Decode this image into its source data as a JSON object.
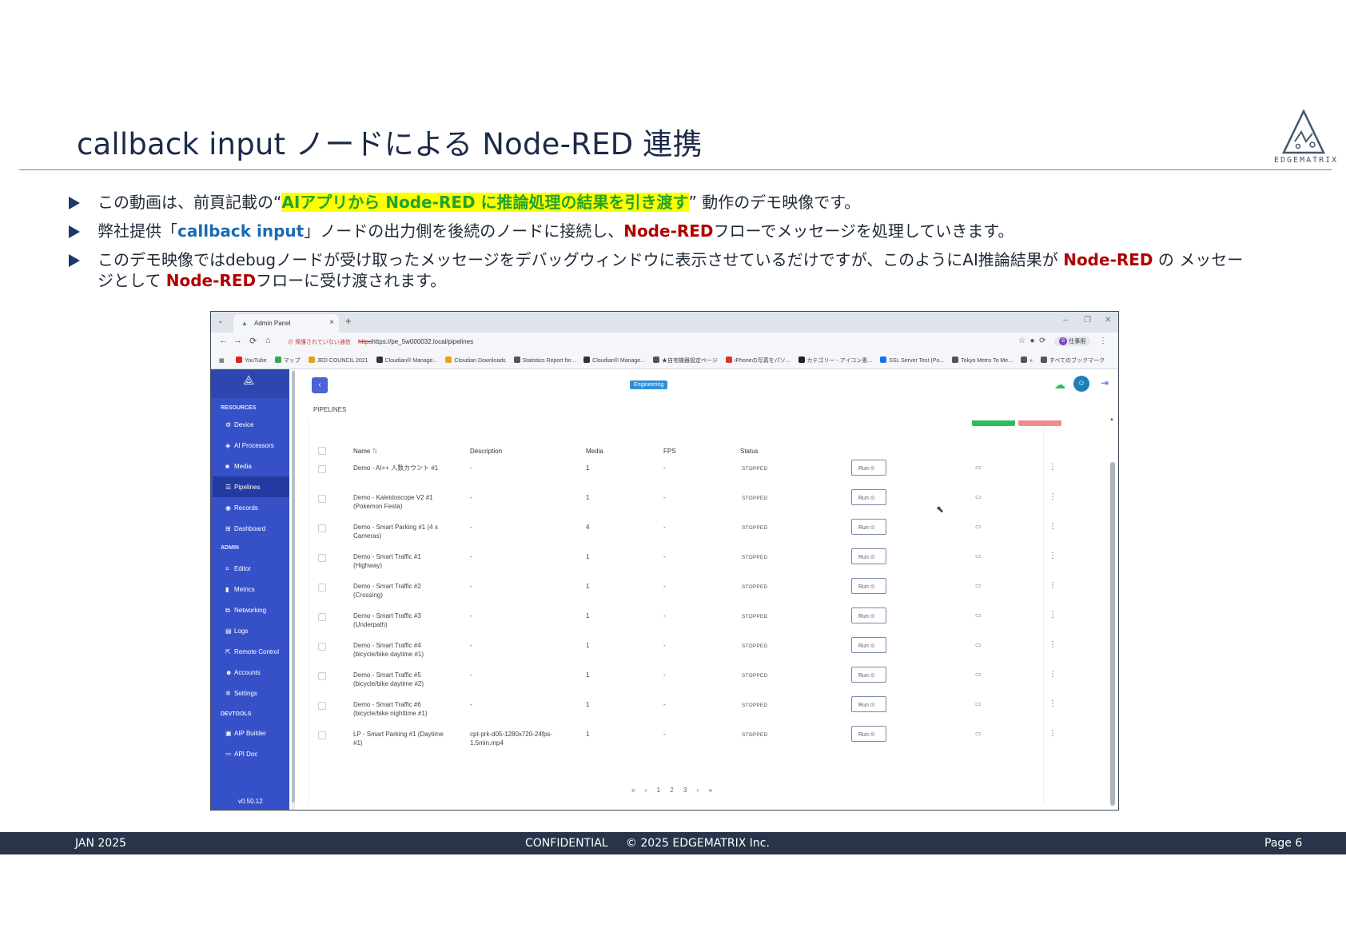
{
  "slide": {
    "title": "callback input ノードによる Node-RED 連携",
    "logo_text": "EDGEMATRIX"
  },
  "bullets": {
    "b1_pre": "この動画は、前頁記載の“",
    "b1_hl": "AIアプリから Node-RED に推論処理の結果を引き渡す",
    "b1_post": "” 動作のデモ映像です。",
    "b2_pre": "弊社提供「",
    "b2_hl": "callback input",
    "b2_mid": "」ノードの出力側を後続のノードに接続し、",
    "b2_red": "Node-RED",
    "b2_post": "フローでメッセージを処理していきます。",
    "b3_pre": "このデモ映像ではdebugノードが受け取ったメッセージをデバッグウィンドウに表示させているだけですが、このようにAI推論結果が ",
    "b3_red1": "Node-RED",
    "b3_mid": " の メッセージとして ",
    "b3_red2": "Node-RED",
    "b3_post": "フローに受け渡されます。"
  },
  "browser": {
    "tab_title": "Admin Panel",
    "security_warning": "保護されていない通信",
    "url": "https://pe_5w000032.local/pipelines",
    "profile": "仕事用",
    "bookmarks": [
      "YouTube",
      "マップ",
      "JED COUNCIL 2021",
      "Cloudian® Manage...",
      "Cloudian Downloads",
      "Statistics Report for...",
      "Cloudian® Manage...",
      "★自宅機器設定ページ",
      "iPhoneの写真をパソ...",
      "カテゴリー - アイコン素...",
      "SSL Server Test (Po...",
      "Tokyo Metro To Me...",
      "»",
      "すべてのブックマーク"
    ],
    "bookmark_colors": [
      "#e62117",
      "#34a853",
      "#e3a21a",
      "#333333",
      "#e8a317",
      "#555555",
      "#333333",
      "#555555",
      "#d9342b",
      "#222222",
      "#1a73e8",
      "#555555",
      "#555555",
      "#555555"
    ]
  },
  "app": {
    "env_badge": "Engineering",
    "breadcrumb": "PIPELINES",
    "version": "v0.50.12",
    "sections": {
      "resources": "RESOURCES",
      "admin": "ADMIN",
      "devtools": "DEVTOOLS"
    },
    "nav": {
      "device": "Device",
      "ai_processors": "AI Processors",
      "media": "Media",
      "pipelines": "Pipelines",
      "records": "Records",
      "dashboard": "Dashboard",
      "editor": "Editor",
      "metrics": "Metrics",
      "networking": "Networking",
      "logs": "Logs",
      "remote_control": "Remote Control",
      "accounts": "Accounts",
      "settings": "Settings",
      "aip_builder": "AIP Builder",
      "api_doc": "API Doc"
    },
    "columns": {
      "name": "Name",
      "description": "Description",
      "media": "Media",
      "fps": "FPS",
      "status": "Status"
    },
    "run_label": "Run",
    "rows": [
      {
        "name1": "Demo - AI++ 人数カウント #1",
        "name2": "",
        "desc1": "-",
        "desc2": "",
        "media": "1",
        "fps": "-",
        "status": "STOPPED"
      },
      {
        "name1": "Demo - Kaleidoscope V2 #1",
        "name2": "(Pokemon Festa)",
        "desc1": "-",
        "desc2": "",
        "media": "1",
        "fps": "-",
        "status": "STOPPED"
      },
      {
        "name1": "Demo - Smart Parking #1 (4 x",
        "name2": "Cameras)",
        "desc1": "-",
        "desc2": "",
        "media": "4",
        "fps": "-",
        "status": "STOPPED"
      },
      {
        "name1": "Demo - Smart Traffic #1",
        "name2": "(Highway)",
        "desc1": "-",
        "desc2": "",
        "media": "1",
        "fps": "-",
        "status": "STOPPED"
      },
      {
        "name1": "Demo - Smart Traffic #2",
        "name2": "(Crossing)",
        "desc1": "-",
        "desc2": "",
        "media": "1",
        "fps": "-",
        "status": "STOPPED"
      },
      {
        "name1": "Demo - Smart Traffic #3",
        "name2": "(Underpath)",
        "desc1": "-",
        "desc2": "",
        "media": "1",
        "fps": "-",
        "status": "STOPPED"
      },
      {
        "name1": "Demo - Smart Traffic #4",
        "name2": "(bicycle/bike daytime #1)",
        "desc1": "-",
        "desc2": "",
        "media": "1",
        "fps": "-",
        "status": "STOPPED"
      },
      {
        "name1": "Demo - Smart Traffic #5",
        "name2": "(bicycle/bike daytime #2)",
        "desc1": "-",
        "desc2": "",
        "media": "1",
        "fps": "-",
        "status": "STOPPED"
      },
      {
        "name1": "Demo - Smart Traffic #6",
        "name2": "(bicycle/bike nighttime #1)",
        "desc1": "-",
        "desc2": "",
        "media": "1",
        "fps": "-",
        "status": "STOPPED"
      },
      {
        "name1": "LP - Smart Parking #1 (Daytime",
        "name2": "#1)",
        "desc1": "cpt-prk-d05-1280x720-24fps-",
        "desc2": "1.5min.mp4",
        "media": "1",
        "fps": "-",
        "status": "STOPPED"
      }
    ],
    "pagination": {
      "first": "«",
      "prev": "‹",
      "p1": "1",
      "p2": "2",
      "p3": "3",
      "next": "›",
      "last": "»"
    }
  },
  "footer": {
    "date": "JAN 2025",
    "confidential": "CONFIDENTIAL",
    "copyright": "© 2025 EDGEMATRIX Inc.",
    "page": "Page 6"
  }
}
